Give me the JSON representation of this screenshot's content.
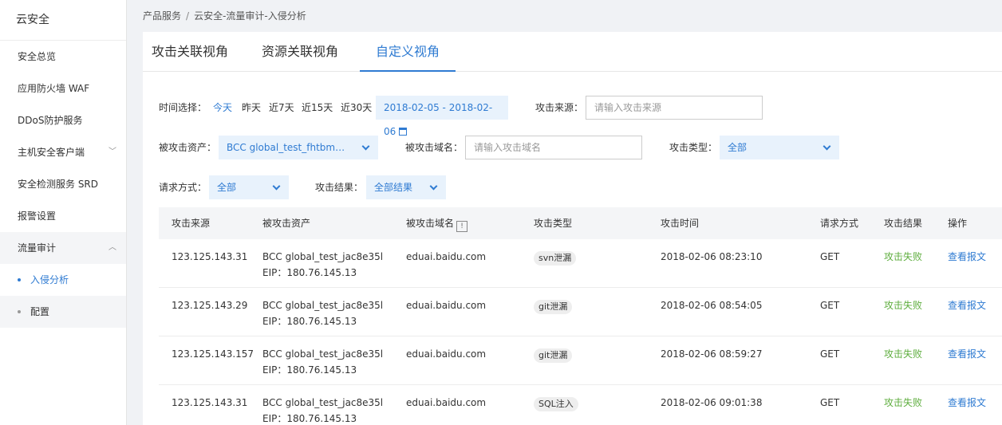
{
  "sidebar": {
    "title": "云安全",
    "items": [
      {
        "label": "安全总览"
      },
      {
        "label": "应用防火墙 WAF"
      },
      {
        "label": "DDoS防护服务"
      },
      {
        "label": "主机安全客户端"
      },
      {
        "label": "安全检测服务 SRD"
      },
      {
        "label": "报警设置"
      },
      {
        "label": "流量审计"
      }
    ],
    "sub_items": [
      {
        "label": "入侵分析"
      },
      {
        "label": "配置"
      }
    ]
  },
  "breadcrumb": {
    "root": "产品服务",
    "separator": "/",
    "current": "云安全-流量审计-入侵分析"
  },
  "tabs": [
    {
      "label": "攻击关联视角"
    },
    {
      "label": "资源关联视角"
    },
    {
      "label": "自定义视角"
    }
  ],
  "filters": {
    "time_label": "时间选择：",
    "quick": [
      "今天",
      "昨天",
      "近7天",
      "近15天",
      "近30天"
    ],
    "date_range": "2018-02-05 - 2018-02-06",
    "source_label": "攻击来源：",
    "source_placeholder": "请输入攻击来源",
    "asset_label": "被攻击资产：",
    "asset_value": "BCC global_test_fhtbmz1a...",
    "domain_label": "被攻击域名：",
    "domain_placeholder": "请输入攻击域名",
    "type_label": "攻击类型：",
    "type_value": "全部",
    "method_label": "请求方式：",
    "method_value": "全部",
    "result_label": "攻击结果：",
    "result_value": "全部结果"
  },
  "table": {
    "columns": [
      "攻击来源",
      "被攻击资产",
      "被攻击域名",
      "攻击类型",
      "攻击时间",
      "请求方式",
      "攻击结果",
      "操作"
    ],
    "info_glyph": "!",
    "rows": [
      {
        "source": "123.125.143.31",
        "asset": "BCC global_test_jac8e35l",
        "eip": "EIP：180.76.145.13",
        "domain": "eduai.baidu.com",
        "type": "svn泄漏",
        "time": "2018-02-06 08:23:10",
        "method": "GET",
        "result": "攻击失败",
        "action": "查看报文"
      },
      {
        "source": "123.125.143.29",
        "asset": "BCC global_test_jac8e35l",
        "eip": "EIP：180.76.145.13",
        "domain": "eduai.baidu.com",
        "type": "git泄漏",
        "time": "2018-02-06 08:54:05",
        "method": "GET",
        "result": "攻击失败",
        "action": "查看报文"
      },
      {
        "source": "123.125.143.157",
        "asset": "BCC global_test_jac8e35l",
        "eip": "EIP：180.76.145.13",
        "domain": "eduai.baidu.com",
        "type": "git泄漏",
        "time": "2018-02-06 08:59:27",
        "method": "GET",
        "result": "攻击失败",
        "action": "查看报文"
      },
      {
        "source": "123.125.143.31",
        "asset": "BCC global_test_jac8e35l",
        "eip": "EIP：180.76.145.13",
        "domain": "eduai.baidu.com",
        "type": "SQL注入",
        "time": "2018-02-06 09:01:38",
        "method": "GET",
        "result": "攻击失败",
        "action": "查看报文"
      }
    ]
  },
  "colors": {
    "accent": "#2f7bd2",
    "fail_green": "#5fae3f"
  }
}
